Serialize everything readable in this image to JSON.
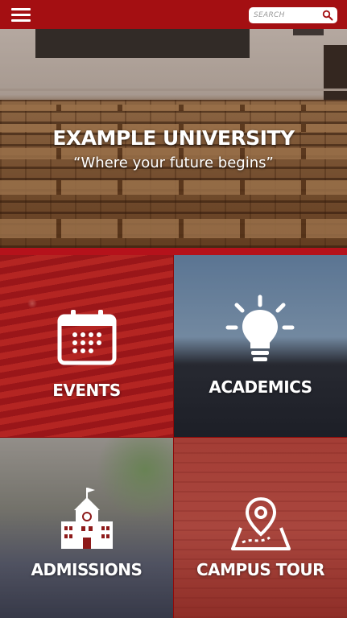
{
  "header": {
    "search_placeholder": "SEARCH",
    "menu_icon": "hamburger-menu-icon",
    "search_icon": "magnifier-icon"
  },
  "hero": {
    "title": "EXAMPLE UNIVERSITY",
    "tagline": "“Where your future begins”"
  },
  "tiles": [
    {
      "label": "EVENTS",
      "icon": "calendar-icon"
    },
    {
      "label": "ACADEMICS",
      "icon": "lightbulb-icon"
    },
    {
      "label": "ADMISSIONS",
      "icon": "school-building-icon"
    },
    {
      "label": "CAMPUS TOUR",
      "icon": "map-pin-icon"
    }
  ],
  "colors": {
    "brand_red": "#a40f12",
    "accent_strip": "#b5121b"
  }
}
